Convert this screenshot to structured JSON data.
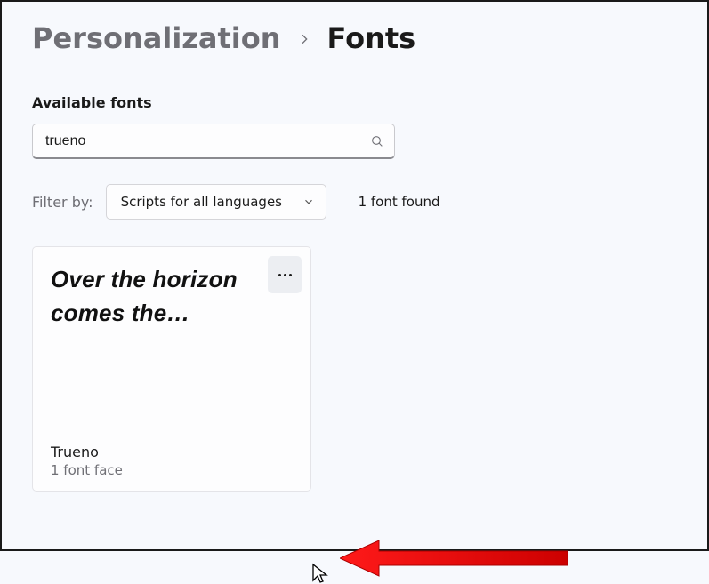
{
  "breadcrumb": {
    "parent": "Personalization",
    "current": "Fonts"
  },
  "section_label": "Available fonts",
  "search": {
    "value": "trueno",
    "placeholder": ""
  },
  "filter": {
    "label": "Filter by:",
    "selected": "Scripts for all languages"
  },
  "results": {
    "count_text": "1 font found"
  },
  "card": {
    "preview_text": "Over the horizon comes the…",
    "name": "Trueno",
    "faces": "1 font face"
  }
}
